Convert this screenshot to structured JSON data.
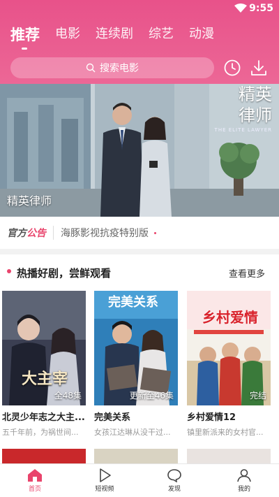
{
  "status": {
    "time": "9:55"
  },
  "tabs": [
    "推荐",
    "电影",
    "连续剧",
    "综艺",
    "动漫"
  ],
  "search": {
    "placeholder": "搜索电影"
  },
  "banner": {
    "title": "精英律师",
    "calligraphy_line1": "精英",
    "calligraphy_line2": "律师",
    "subtitle": "THE ELITE LAWYER"
  },
  "notice": {
    "brand_part1": "官方",
    "brand_part2": "公告",
    "text": "海豚影视抗疫特别版"
  },
  "section": {
    "title": "热播好剧，尝鲜观看",
    "more": "查看更多"
  },
  "cards": [
    {
      "name": "北灵少年志之大主...",
      "desc": "五千年前，为祸世间...",
      "badge": "全48集",
      "poster_text": "大主宰"
    },
    {
      "name": "完美关系",
      "desc": "女孩江达琳从没干过...",
      "badge": "更新至46集",
      "poster_text": "完美关系"
    },
    {
      "name": "乡村爱情12",
      "desc": "镇里新派来的女村官...",
      "badge": "完结",
      "poster_text": "乡村爱情"
    }
  ],
  "bottom_nav": [
    {
      "label": "首页",
      "icon": "home-icon"
    },
    {
      "label": "短视频",
      "icon": "play-icon"
    },
    {
      "label": "发现",
      "icon": "chat-icon"
    },
    {
      "label": "我的",
      "icon": "user-icon"
    }
  ],
  "colors": {
    "accent": "#e9446c",
    "header": "#e8528a"
  }
}
